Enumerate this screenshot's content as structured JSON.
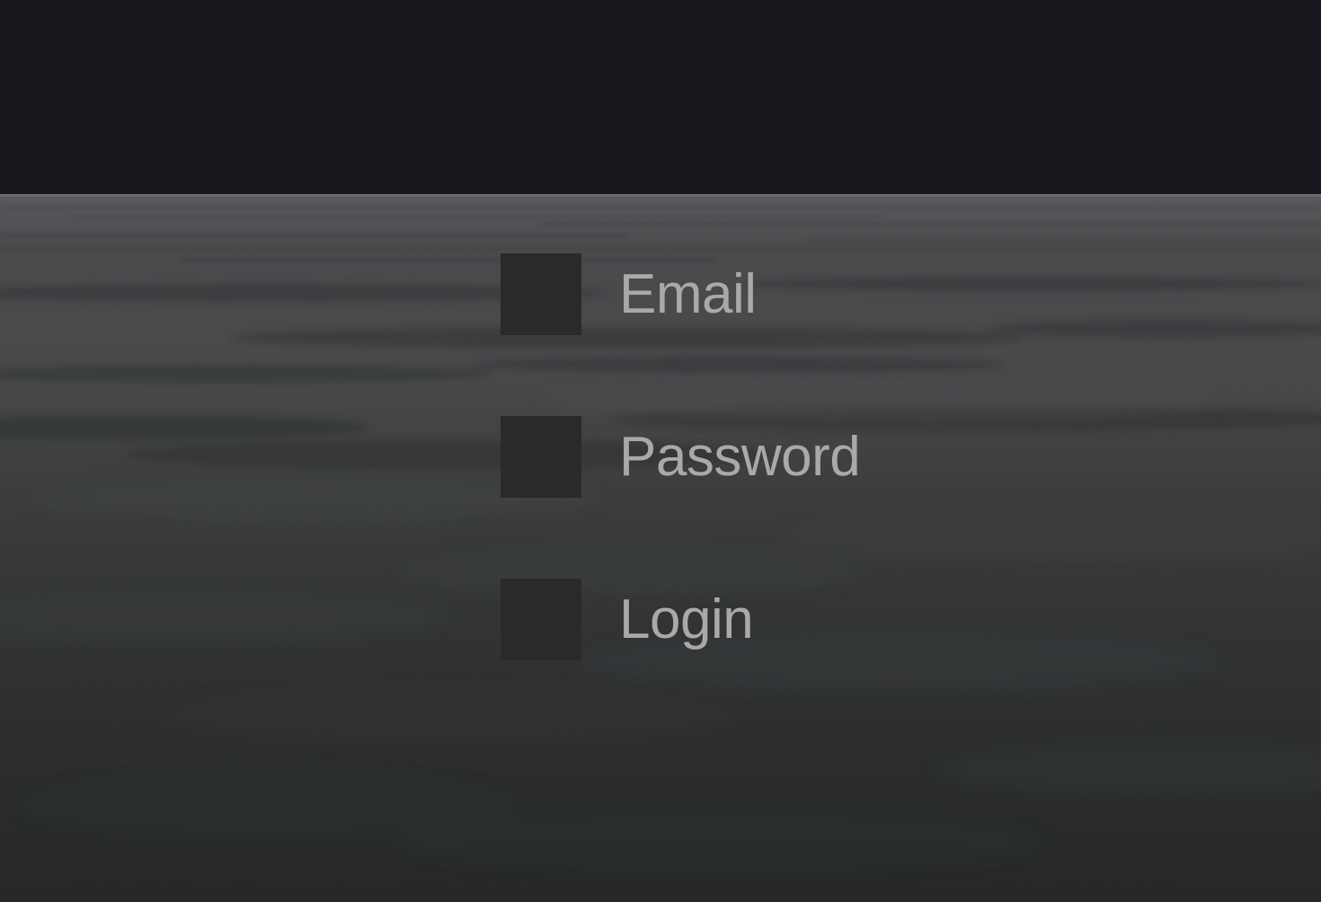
{
  "form": {
    "email_label": "Email",
    "password_label": "Password",
    "login_label": "Login"
  },
  "colors": {
    "sky": "#17161d",
    "sea_far": "#5a5b5e",
    "sea_near": "#262828",
    "input_box": "#2a2a2c",
    "label_text": "#a9a9a9"
  }
}
